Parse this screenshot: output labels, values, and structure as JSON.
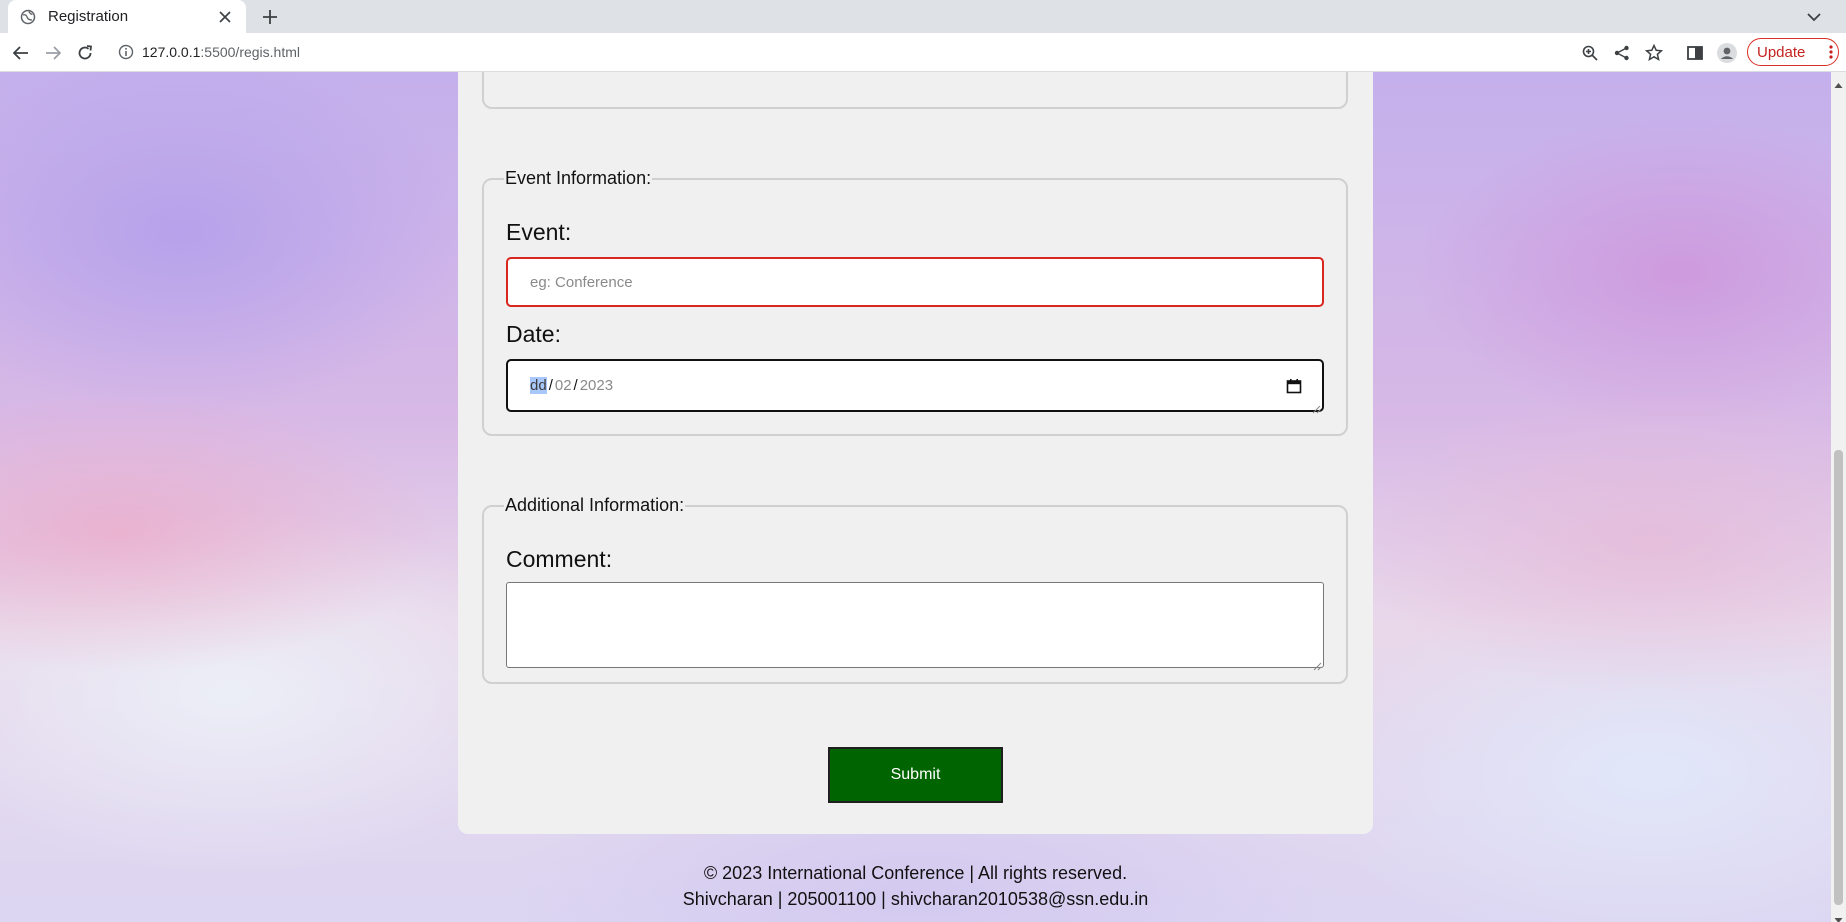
{
  "browser": {
    "tab_title": "Registration",
    "url_host": "127.0.0.1",
    "url_rest": ":5500/regis.html",
    "update_label": "Update"
  },
  "form": {
    "event_section": {
      "legend": "Event Information:",
      "event_label": "Event:",
      "event_placeholder": "eg: Conference",
      "date_label": "Date:",
      "date_day": "dd",
      "date_month": "02",
      "date_year": "2023",
      "date_separator": "/"
    },
    "additional_section": {
      "legend": "Additional Information:",
      "comment_label": "Comment:",
      "comment_value": ""
    },
    "submit_label": "Submit"
  },
  "footer": {
    "line1": "© 2023 International Conference | All rights reserved.",
    "line2": "Shivcharan | 205001100 | shivcharan2010538@ssn.edu.in"
  },
  "colors": {
    "submit_bg": "#006400",
    "invalid_border": "#d9261e",
    "valid_border": "#1e7d1e",
    "update_accent": "#c5221f"
  },
  "icons": [
    "globe-icon",
    "close-icon",
    "plus-icon",
    "chevron-down-icon",
    "back-arrow-icon",
    "forward-arrow-icon",
    "reload-icon",
    "info-icon",
    "zoom-icon",
    "share-icon",
    "star-icon",
    "side-panel-icon",
    "profile-icon",
    "more-vert-icon",
    "calendar-icon"
  ]
}
